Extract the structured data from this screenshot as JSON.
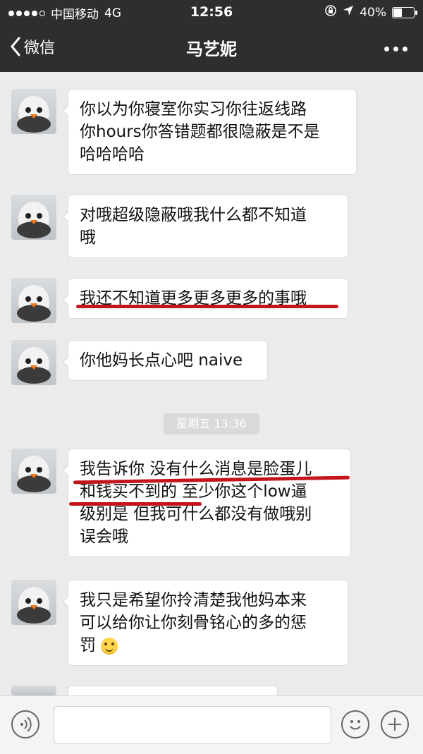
{
  "status_bar": {
    "carrier": "中国移动",
    "network": "4G",
    "time": "12:56",
    "battery": "40%"
  },
  "nav": {
    "back_label": "微信",
    "title": "马艺妮"
  },
  "messages": [
    {
      "lines": [
        "你以为你寝室你实习你往返线路",
        "你hours你答错题都很隐蔽是不是",
        "哈哈哈哈"
      ]
    },
    {
      "lines": [
        "对哦超级隐蔽哦我什么都不知道",
        "哦"
      ]
    },
    {
      "lines": [
        "我还不知道更多更多更多的事哦"
      ]
    },
    {
      "lines": [
        "你他妈长点心吧 naive"
      ]
    },
    {
      "lines": [
        "我告诉你 没有什么消息是脸蛋儿",
        "和钱买不到的 至少你这个low逼",
        "级别是 但我可什么都没有做哦别",
        "误会哦"
      ]
    },
    {
      "lines": [
        "我只是希望你拎清楚我他妈本来",
        "可以给你让你刻骨铭心的多的惩",
        "罚"
      ]
    }
  ],
  "timestamp": "星期五 13:36",
  "icons": {
    "voice": "voice-icon",
    "emoji": "emoji-icon",
    "plus": "plus-icon",
    "back": "chevron-left-icon",
    "more": "more-icon"
  },
  "colors": {
    "nav_bg": "#2e2e31",
    "chat_bg": "#ebebeb",
    "bubble_bg": "#ffffff",
    "underline": "#c4141b"
  }
}
